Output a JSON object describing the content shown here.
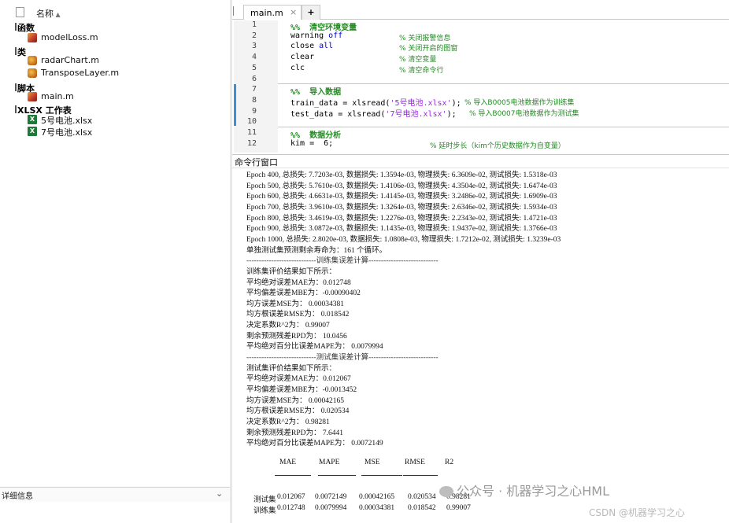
{
  "browser": {
    "header": "名称",
    "groups": [
      {
        "label": "函数",
        "items": [
          "modelLoss.m"
        ]
      },
      {
        "label": "类",
        "items": [
          "radarChart.m",
          "TransposeLayer.m"
        ]
      },
      {
        "label": "脚本",
        "items": [
          "main.m"
        ]
      },
      {
        "label": "XLSX 工作表",
        "items": [
          "5号电池.xlsx",
          "7号电池.xlsx"
        ]
      }
    ],
    "details": "详细信息"
  },
  "editor": {
    "tab": "main.m",
    "tab_close": "×",
    "tab_add": "+",
    "lines": [
      {
        "n": "1",
        "parts": [
          [
            "sec",
            "%%  清空环境变量"
          ]
        ]
      },
      {
        "n": "2",
        "parts": [
          [
            "",
            "warning "
          ],
          [
            "kw",
            "off"
          ]
        ],
        "comment": "% 关闭报警信息"
      },
      {
        "n": "3",
        "parts": [
          [
            "",
            "close "
          ],
          [
            "kw",
            "all"
          ]
        ],
        "comment": "% 关闭开启的图窗"
      },
      {
        "n": "4",
        "parts": [
          [
            "",
            "clear"
          ]
        ],
        "comment": "% 清空变量"
      },
      {
        "n": "5",
        "parts": [
          [
            "",
            "clc"
          ]
        ],
        "comment": "% 清空命令行"
      },
      {
        "n": "6",
        "parts": []
      },
      {
        "n": "7",
        "parts": [
          [
            "sec",
            "%%  导入数据"
          ]
        ]
      },
      {
        "n": "8",
        "parts": [
          [
            "",
            "train_data = xlsread("
          ],
          [
            "str",
            "'5号电池.xlsx'"
          ],
          [
            "",
            ");"
          ]
        ],
        "comment": "% 导入B0005电池数据作为训练集"
      },
      {
        "n": "9",
        "parts": [
          [
            "",
            "test_data = xlsread("
          ],
          [
            "str",
            "'7号电池.xlsx'"
          ],
          [
            "",
            ");"
          ]
        ],
        "comment": "% 导入B0007电池数据作为测试集"
      },
      {
        "n": "10",
        "parts": []
      },
      {
        "n": "11",
        "parts": [
          [
            "sec",
            "%%  数据分析"
          ]
        ]
      },
      {
        "n": "12",
        "parts": [
          [
            "",
            "kim =  6;"
          ]
        ],
        "comment": "% 延时步长（kim个历史数据作为自变量）"
      }
    ]
  },
  "command": {
    "title": "命令行窗口",
    "lines": [
      "Epoch 400, 总损失: 7.7203e-03, 数据损失: 1.3594e-03, 物理损失: 6.3609e-02, 测试损失: 1.5318e-03",
      "Epoch 500, 总损失: 5.7610e-03, 数据损失: 1.4106e-03, 物理损失: 4.3504e-02, 测试损失: 1.6474e-03",
      "Epoch 600, 总损失: 4.6631e-03, 数据损失: 1.4145e-03, 物理损失: 3.2486e-02, 测试损失: 1.6909e-03",
      "Epoch 700, 总损失: 3.9610e-03, 数据损失: 1.3264e-03, 物理损失: 2.6346e-02, 测试损失: 1.5934e-03",
      "Epoch 800, 总损失: 3.4619e-03, 数据损失: 1.2276e-03, 物理损失: 2.2343e-02, 测试损失: 1.4721e-03",
      "Epoch 900, 总损失: 3.0872e-03, 数据损失: 1.1435e-03, 物理损失: 1.9437e-02, 测试损失: 1.3766e-03",
      "Epoch 1000, 总损失: 2.8020e-03, 数据损失: 1.0808e-03, 物理损失: 1.7212e-02, 测试损失: 1.3239e-03",
      "单独测试集预测剩余寿命为：161 个循环。",
      "----------------------------训练集误差计算----------------------------",
      "训练集评价结果如下所示：",
      "平均绝对误差MAE为：0.012748",
      "平均偏差误差MBE为：-0.00090402",
      "均方误差MSE为：       0.00034381",
      "均方根误差RMSE为：     0.018542",
      "决定系数R^2为：    0.99007",
      "剩余预测残差RPD为：     10.0456",
      "平均绝对百分比误差MAPE为：      0.0079994",
      "----------------------------测试集误差计算----------------------------",
      "测试集评价结果如下所示：",
      "平均绝对误差MAE为：0.012067",
      "平均偏差误差MBE为：-0.0013452",
      "均方误差MSE为：       0.00042165",
      "均方根误差RMSE为：     0.020534",
      "决定系数R^2为：    0.98281",
      "剩余预测残差RPD为：     7.6441",
      "平均绝对百分比误差MAPE为：    0.0072149"
    ],
    "table": {
      "headers": [
        "MAE",
        "MAPE",
        "MSE",
        "RMSE",
        "R2"
      ],
      "rows": [
        {
          "label": "测试集",
          "values": [
            "0.012067",
            "0.0072149",
            "0.00042165",
            "0.020534",
            "0.98281"
          ]
        },
        {
          "label": "训练集",
          "values": [
            "0.012748",
            "0.0079994",
            "0.00034381",
            "0.018542",
            "0.99007"
          ]
        }
      ]
    }
  },
  "watermark": {
    "main": "公众号 · 机器学习之心HML",
    "sub": "CSDN @机器学习之心"
  }
}
